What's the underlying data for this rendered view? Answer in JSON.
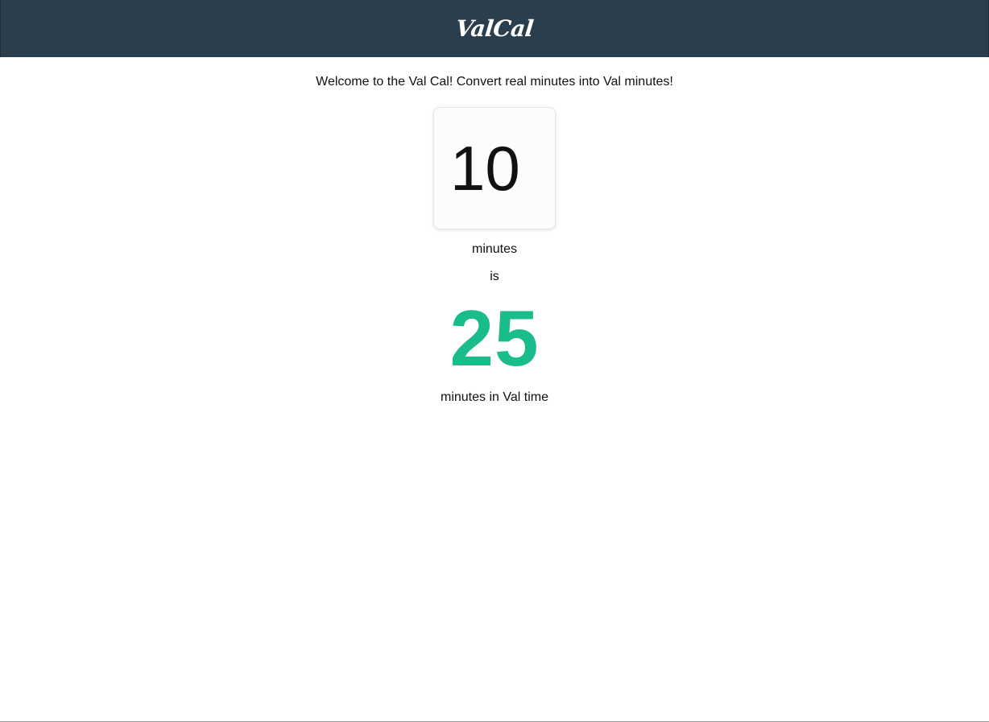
{
  "header": {
    "logo_text": "ValCal",
    "background_color": "#2b3e4d"
  },
  "main": {
    "welcome_text": "Welcome to the Val Cal! Convert real minutes into Val minutes!",
    "input_value": "10",
    "input_unit_label": "minutes",
    "connector_text": "is",
    "result_value": "25",
    "result_color": "#1abc8c",
    "result_label": "minutes in Val time"
  }
}
